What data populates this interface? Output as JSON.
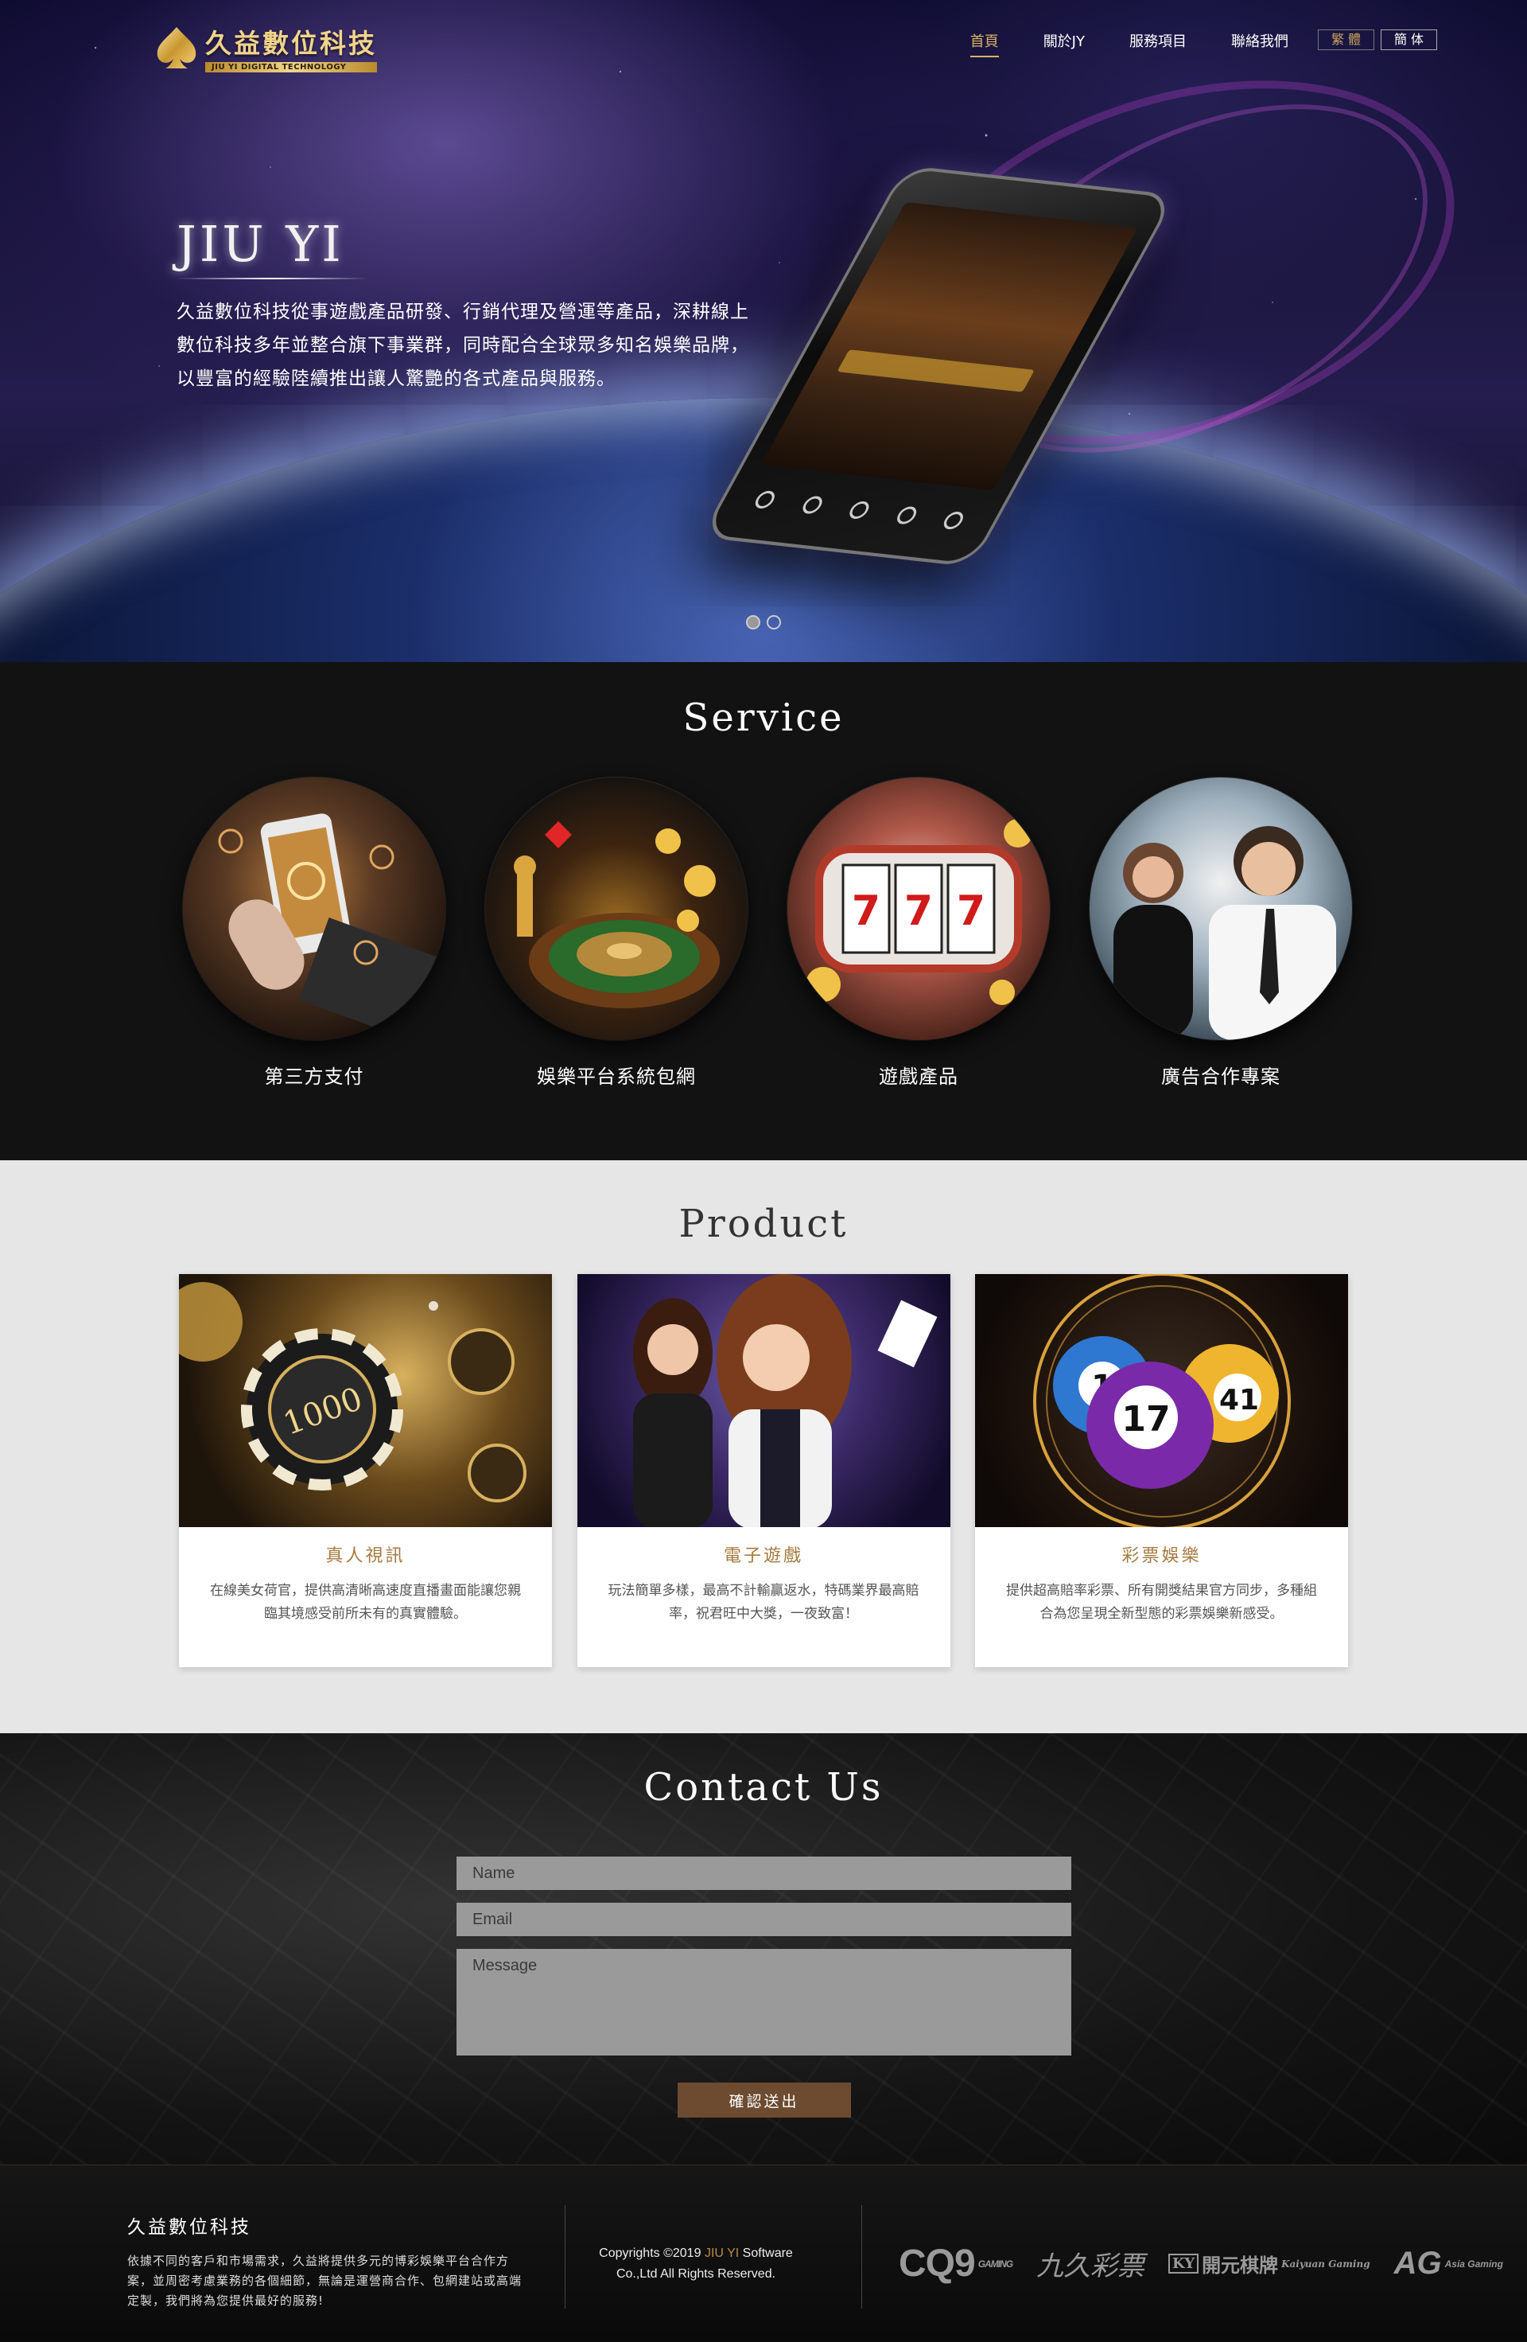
{
  "header": {
    "logo_cn": "久益數位科技",
    "logo_en": "JIU YI DIGITAL TECHNOLOGY",
    "nav": [
      {
        "label": "首頁",
        "active": true
      },
      {
        "label": "關於JY",
        "active": false
      },
      {
        "label": "服務項目",
        "active": false
      },
      {
        "label": "聯絡我們",
        "active": false
      }
    ],
    "lang": [
      {
        "label": "繁 體",
        "active": true
      },
      {
        "label": "簡 体",
        "active": false
      }
    ]
  },
  "hero": {
    "title": "JIU YI",
    "lines": [
      "久益數位科技從事遊戲產品研發、行銷代理及營運等產品，深耕線上",
      "數位科技多年並整合旗下事業群，同時配合全球眾多知名娛樂品牌，",
      "以豐富的經驗陸續推出讓人驚艷的各式產品與服務。"
    ],
    "slides_total": 2,
    "slide_active": 1
  },
  "service": {
    "title": "Service",
    "items": [
      {
        "label": "第三方支付",
        "icon": "mobile-payment-icon"
      },
      {
        "label": "娛樂平台系統包網",
        "icon": "roulette-icon"
      },
      {
        "label": "遊戲產品",
        "icon": "slot-machine-icon"
      },
      {
        "label": "廣告合作專案",
        "icon": "business-people-icon"
      }
    ]
  },
  "product": {
    "title": "Product",
    "items": [
      {
        "name": "真人視訊",
        "desc": "在線美女荷官，提供高清晰高速度直播畫面能讓您親臨其境感受前所未有的真實體驗。",
        "chip_label": "1000"
      },
      {
        "name": "電子遊戲",
        "desc": "玩法簡單多樣，最高不計輸贏返水，特碼業界最高賠率，祝君旺中大獎，一夜致富！"
      },
      {
        "name": "彩票娛樂",
        "desc": "提供超高賠率彩票、所有開獎結果官方同步，多種組合為您呈現全新型態的彩票娛樂新感受。",
        "balls": [
          "1",
          "17",
          "41"
        ]
      }
    ]
  },
  "contact": {
    "title": "Contact Us",
    "name_placeholder": "Name",
    "email_placeholder": "Email",
    "message_placeholder": "Message",
    "submit_label": "確認送出"
  },
  "footer": {
    "brand": "久益數位科技",
    "about": "依據不同的客戶和市場需求，久益將提供多元的博彩娛樂平台合作方案，並周密考慮業務的各個細節，無論是運營商合作、包網建站或高端定製，我們將為您提供最好的服務!",
    "copyright_prefix": "Copyrights ©2019",
    "copyright_brand": "JIU YI",
    "copyright_suffix": "Software",
    "copyright_line2": "Co.,Ltd All Rights Reserved.",
    "partners": [
      {
        "name": "CQ9",
        "sub": "GAMING"
      },
      {
        "name": "九久彩票",
        "sub": ""
      },
      {
        "name": "開元棋牌",
        "sub": "Kaiyuan Gaming",
        "mark": "KY"
      },
      {
        "name": "AG",
        "sub": "Asia Gaming"
      }
    ]
  },
  "colors": {
    "gold": "#d9b266",
    "product_name": "#a57b3f",
    "submit_bg": "#6d4b30"
  }
}
